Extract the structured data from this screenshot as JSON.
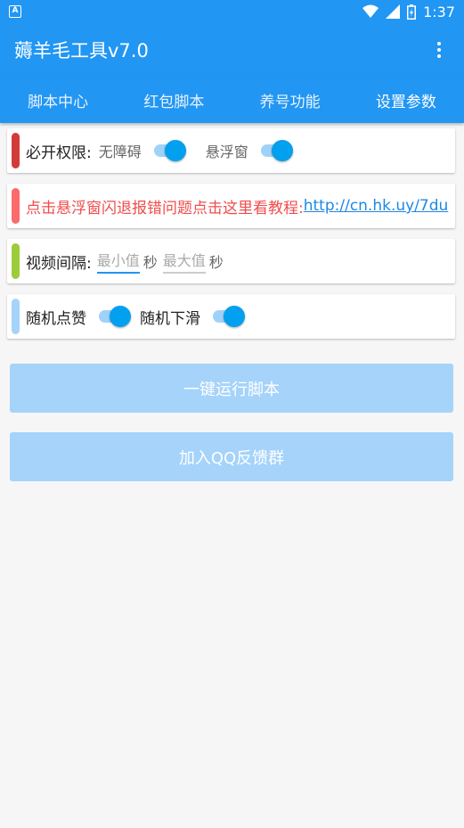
{
  "status_bar": {
    "badge": "A",
    "time": "1:37"
  },
  "app_bar": {
    "title": "薅羊毛工具v7.0"
  },
  "tabs": [
    {
      "label": "脚本中心"
    },
    {
      "label": "红包脚本"
    },
    {
      "label": "养号功能"
    },
    {
      "label": "设置参数"
    }
  ],
  "active_tab": "设置参数",
  "permissions": {
    "label": "必开权限:",
    "accessibility_label": "无障碍",
    "accessibility_on": true,
    "overlay_label": "悬浮窗",
    "overlay_on": true,
    "accent": "#d33a3a"
  },
  "notice": {
    "text": "点击悬浮窗闪退报错问题点击这里看教程:",
    "link": "http://cn.hk.uy/7du",
    "accent": "#fb6b6b"
  },
  "interval": {
    "label": "视频间隔:",
    "min_placeholder": "最小值",
    "max_placeholder": "最大值",
    "unit": "秒",
    "accent": "#9ccc3a"
  },
  "random": {
    "like_label": "随机点赞",
    "like_on": true,
    "scroll_label": "随机下滑",
    "scroll_on": true,
    "accent": "#a5d3fa"
  },
  "buttons": {
    "run": "一键运行脚本",
    "join_qq": "加入QQ反馈群"
  },
  "colors": {
    "primary": "#2196f3",
    "switch_on": "#03a0f0",
    "button_disabled": "#a5d3fa"
  }
}
